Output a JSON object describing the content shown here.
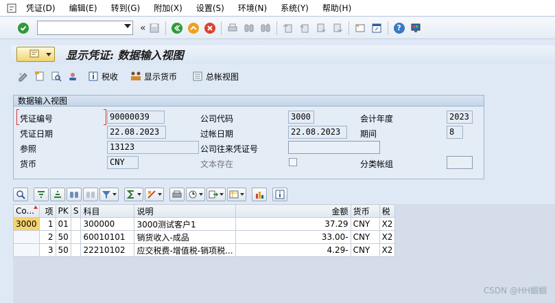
{
  "menubar": {
    "items": [
      {
        "label": "凭证(D)"
      },
      {
        "label": "编辑(E)"
      },
      {
        "label": "转到(G)"
      },
      {
        "label": "附加(X)"
      },
      {
        "label": "设置(S)"
      },
      {
        "label": "环境(N)"
      },
      {
        "label": "系统(Y)"
      },
      {
        "label": "帮助(H)"
      }
    ]
  },
  "toolbar": {
    "command_value": "",
    "back_glyph": "«"
  },
  "title": {
    "text": "显示凭证: 数据输入视图"
  },
  "app_toolbar": {
    "tax_label": "税收",
    "currency_label": "显示货币",
    "gl_view_label": "总帐视图"
  },
  "header_box": {
    "title": "数据输入视图",
    "fields": {
      "doc_number_label": "凭证编号",
      "doc_number_value": "90000039",
      "company_code_label": "公司代码",
      "company_code_value": "3000",
      "fiscal_year_label": "会计年度",
      "fiscal_year_value": "2023",
      "doc_date_label": "凭证日期",
      "doc_date_value": "22.08.2023",
      "posting_date_label": "过帐日期",
      "posting_date_value": "22.08.2023",
      "period_label": "期间",
      "period_value": "8",
      "reference_label": "参照",
      "reference_value": "13123",
      "intercompany_label": "公司往来凭证号",
      "intercompany_value": "",
      "currency_label": "货币",
      "currency_value": "CNY",
      "text_exists_label": "文本存在",
      "ledger_group_label": "分类帐组",
      "ledger_group_value": ""
    }
  },
  "grid": {
    "columns": [
      "Co...",
      "项",
      "PK",
      "S",
      "科目",
      "说明",
      "金额",
      "货币",
      "税"
    ],
    "rows": [
      {
        "co": "3000",
        "item": "1",
        "pk": "01",
        "s": "",
        "account": "300000",
        "desc": "3000测试客户1",
        "amount": "37.29",
        "currency": "CNY",
        "tax": "X2"
      },
      {
        "co": "",
        "item": "2",
        "pk": "50",
        "s": "",
        "account": "60010101",
        "desc": "销货收入-成品",
        "amount": "33.00-",
        "currency": "CNY",
        "tax": "X2"
      },
      {
        "co": "",
        "item": "3",
        "pk": "50",
        "s": "",
        "account": "22210102",
        "desc": "应交税费-增值税-销项税...",
        "amount": "4.29-",
        "currency": "CNY",
        "tax": "X2"
      }
    ]
  },
  "watermark": "CSDN @HH蝈蝈",
  "colors": {
    "background": "#dfe9f5",
    "selected_cell": "#f5d36e",
    "confirm_green": "#2e9a3a",
    "cancel_red": "#d9432e"
  }
}
